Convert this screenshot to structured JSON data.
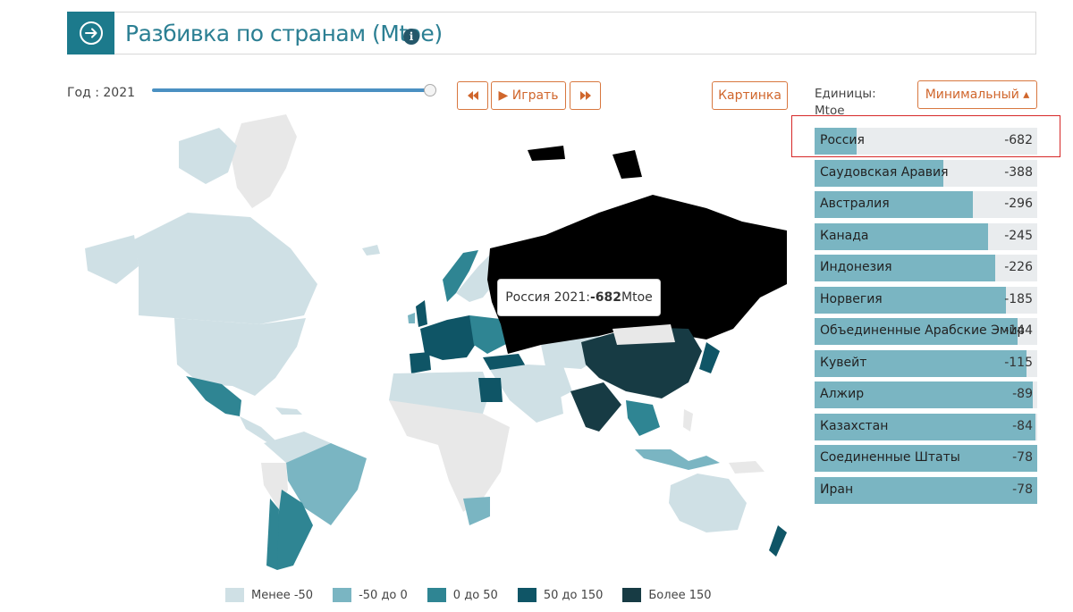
{
  "header": {
    "title": "Разбивка по странам (Mtoe)",
    "icon": "arrow-right-circle-icon",
    "info_icon": "info-icon"
  },
  "controls": {
    "year_label": "Год : 2021",
    "slider_value": 2021,
    "rewind_icon": "fast-backward-icon",
    "play_label": "▶ Играть",
    "forward_icon": "fast-forward-icon",
    "picture_label": "Картинка",
    "units_label_1": "Единицы:",
    "units_label_2": "Mtoe",
    "sort_label": "Минимальный ▴"
  },
  "tooltip": {
    "prefix": "Россия 2021: ",
    "value": "-682",
    "suffix": " Mtoe"
  },
  "countries": [
    {
      "name": "Россия",
      "value": "-682",
      "fraction": 0.19
    },
    {
      "name": "Саудовская Аравия",
      "value": "-388",
      "fraction": 0.58
    },
    {
      "name": "Австралия",
      "value": "-296",
      "fraction": 0.71
    },
    {
      "name": "Канада",
      "value": "-245",
      "fraction": 0.78
    },
    {
      "name": "Индонезия",
      "value": "-226",
      "fraction": 0.81
    },
    {
      "name": "Норвегия",
      "value": "-185",
      "fraction": 0.86
    },
    {
      "name": "Объединенные Арабские Эмираты",
      "value": "-144",
      "fraction": 0.91
    },
    {
      "name": "Кувейт",
      "value": "-115",
      "fraction": 0.95
    },
    {
      "name": "Алжир",
      "value": "-89",
      "fraction": 0.98
    },
    {
      "name": "Казахстан",
      "value": "-84",
      "fraction": 0.99
    },
    {
      "name": "Соединенные Штаты",
      "value": "-78",
      "fraction": 1.0
    },
    {
      "name": "Иран",
      "value": "-78",
      "fraction": 1.0
    }
  ],
  "legend": [
    {
      "label": "Менее -50",
      "color": "#cfe0e5"
    },
    {
      "label": "-50 до 0",
      "color": "#7ab5c2"
    },
    {
      "label": "0 до 50",
      "color": "#2f8593"
    },
    {
      "label": "50 до 150",
      "color": "#0f5566"
    },
    {
      "label": "Более 150",
      "color": "#173b44"
    }
  ],
  "colors": {
    "accent": "#1c7a8c",
    "button": "#d0662c",
    "russia": "#000000",
    "no_data": "#e8e8e8",
    "bar": "#7ab5c2"
  }
}
